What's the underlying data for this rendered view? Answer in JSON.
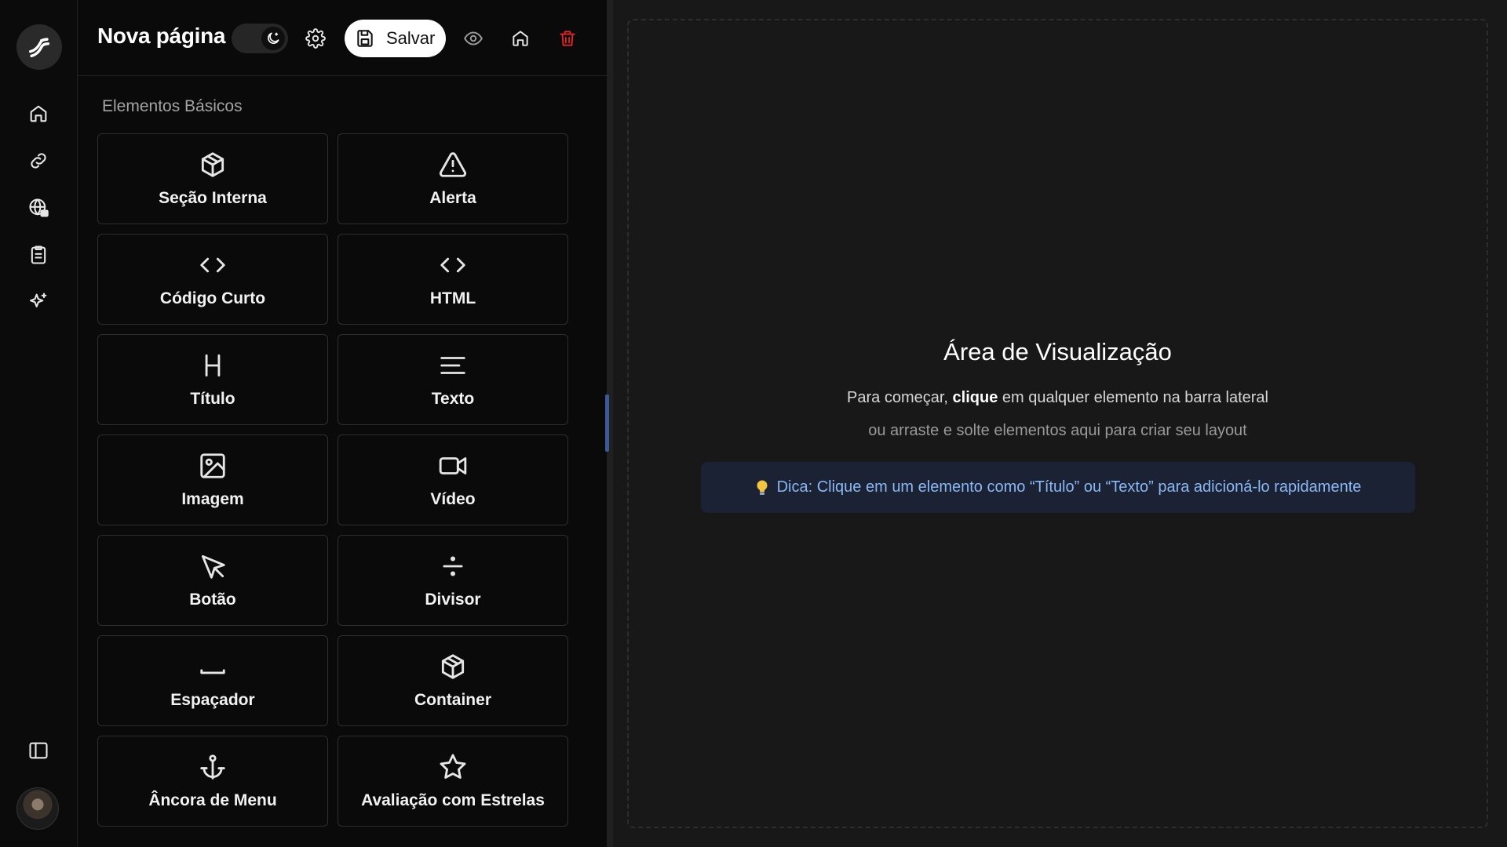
{
  "header": {
    "page_title": "Nova página",
    "save_label": "Salvar"
  },
  "panel": {
    "section_title": "Elementos Básicos",
    "elements": [
      {
        "label": "Seção Interna",
        "icon": "box-icon"
      },
      {
        "label": "Alerta",
        "icon": "alert-triangle-icon"
      },
      {
        "label": "Código Curto",
        "icon": "code-icon"
      },
      {
        "label": "HTML",
        "icon": "code-icon"
      },
      {
        "label": "Título",
        "icon": "heading-icon"
      },
      {
        "label": "Texto",
        "icon": "text-lines-icon"
      },
      {
        "label": "Imagem",
        "icon": "image-icon"
      },
      {
        "label": "Vídeo",
        "icon": "video-icon"
      },
      {
        "label": "Botão",
        "icon": "cursor-icon"
      },
      {
        "label": "Divisor",
        "icon": "divide-icon"
      },
      {
        "label": "Espaçador",
        "icon": "spacer-icon"
      },
      {
        "label": "Container",
        "icon": "box-icon"
      },
      {
        "label": "Âncora de Menu",
        "icon": "anchor-icon"
      },
      {
        "label": "Avaliação com Estrelas",
        "icon": "star-icon"
      }
    ]
  },
  "preview": {
    "title": "Área de Visualização",
    "line1_before": "Para começar,",
    "line1_bold": "clique",
    "line1_after": "em qualquer elemento na barra lateral",
    "line2": "ou arraste e solte elementos aqui para criar seu layout",
    "tip": "Dica: Clique em um elemento como “Título” ou “Texto” para adicioná-lo rapidamente"
  },
  "colors": {
    "accent_blue": "#8ab8f6",
    "tip_bg": "#1b2233",
    "delete_red": "#dc2626",
    "handle_blue": "#3b5998"
  }
}
